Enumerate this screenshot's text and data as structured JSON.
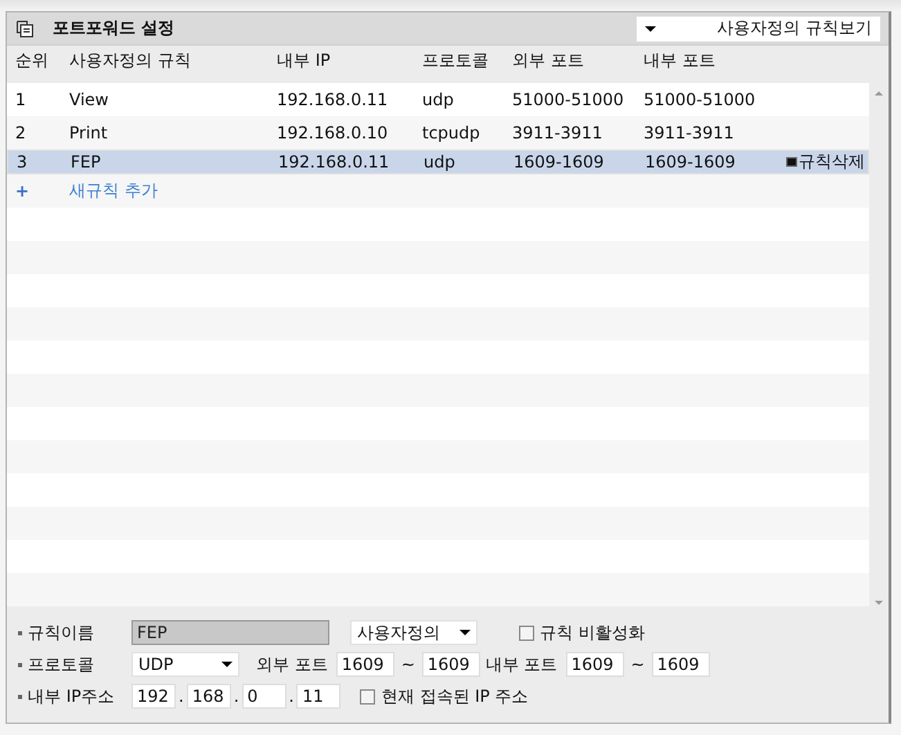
{
  "title": "포트포워드 설정",
  "view_select": {
    "value": "사용자정의 규칙보기"
  },
  "table": {
    "columns": [
      "순위",
      "사용자정의 규칙",
      "내부 IP",
      "프로토콜",
      "외부 포트",
      "내부 포트"
    ],
    "rows": [
      {
        "cells": [
          "1",
          "View",
          "192.168.0.11",
          "udp",
          "51000-51000",
          "51000-51000"
        ],
        "selected": false
      },
      {
        "cells": [
          "2",
          "Print",
          "192.168.0.10",
          "tcpudp",
          "3911-3911",
          "3911-3911"
        ],
        "selected": false
      },
      {
        "cells": [
          "3",
          "FEP",
          "192.168.0.11",
          "udp",
          "1609-1609",
          "1609-1609"
        ],
        "selected": true
      }
    ],
    "delete_button": "규칙삭제",
    "add_link": {
      "icon": "+",
      "label": "새규칙 추가"
    }
  },
  "form": {
    "rule_name": {
      "label": "규칙이름",
      "value": "FEP",
      "disabled": true,
      "type_select": "사용자정의",
      "disable_checkbox": {
        "label": "규칙 비활성화",
        "checked": false
      }
    },
    "protocol": {
      "label": "프로토콜",
      "value": "UDP"
    },
    "external_port": {
      "label": "외부 포트",
      "from": "1609",
      "separator": "~",
      "to": "1609"
    },
    "internal_port": {
      "label": "내부 포트",
      "from": "1609",
      "separator": "~",
      "to": "1609"
    },
    "internal_ip": {
      "label": "내부 IP주소",
      "octets": [
        "192",
        "168",
        "0",
        "11"
      ],
      "separator": ".",
      "current_ip_checkbox": {
        "label": "현재 접속된 IP 주소",
        "checked": false
      }
    }
  }
}
